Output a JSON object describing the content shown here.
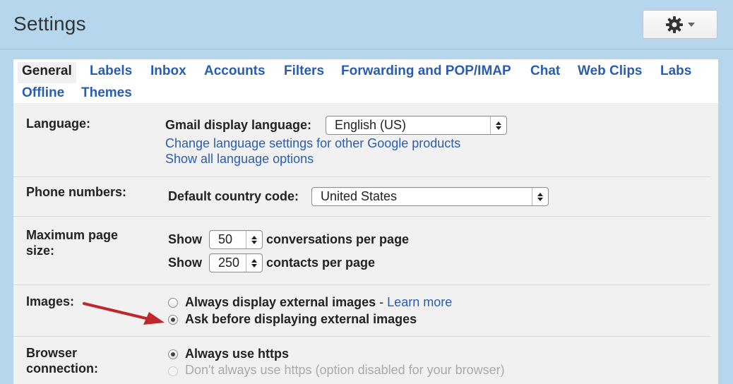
{
  "header": {
    "title": "Settings"
  },
  "tabs": [
    {
      "label": "General",
      "active": true
    },
    {
      "label": "Labels"
    },
    {
      "label": "Inbox"
    },
    {
      "label": "Accounts"
    },
    {
      "label": "Filters"
    },
    {
      "label": "Forwarding and POP/IMAP"
    },
    {
      "label": "Chat"
    },
    {
      "label": "Web Clips"
    },
    {
      "label": "Labs"
    },
    {
      "label": "Offline"
    },
    {
      "label": "Themes"
    }
  ],
  "language": {
    "label": "Language:",
    "field_label": "Gmail display language:",
    "value": "English (US)",
    "link1": "Change language settings for other Google products",
    "link2": "Show all language options"
  },
  "phone": {
    "label": "Phone numbers:",
    "field_label": "Default country code:",
    "value": "United States"
  },
  "page_size": {
    "label_line1": "Maximum page",
    "label_line2": "size:",
    "show": "Show",
    "conversations_value": "50",
    "conversations_suffix": "conversations per page",
    "contacts_value": "250",
    "contacts_suffix": "contacts per page"
  },
  "images": {
    "label": "Images:",
    "option1": "Always display external images",
    "separator": "-",
    "learn_more": "Learn more",
    "option2": "Ask before displaying external images",
    "selected": 2
  },
  "browser": {
    "label_line1": "Browser",
    "label_line2": "connection:",
    "option1": "Always use https",
    "option2": "Don't always use https (option disabled for your browser)",
    "selected": 1
  },
  "colors": {
    "background": "#b5d6ed",
    "link": "#2a5db0",
    "arrow": "#c0272d"
  },
  "icons": {
    "settings": "gear-icon",
    "dropdown": "chevron-down-icon"
  }
}
